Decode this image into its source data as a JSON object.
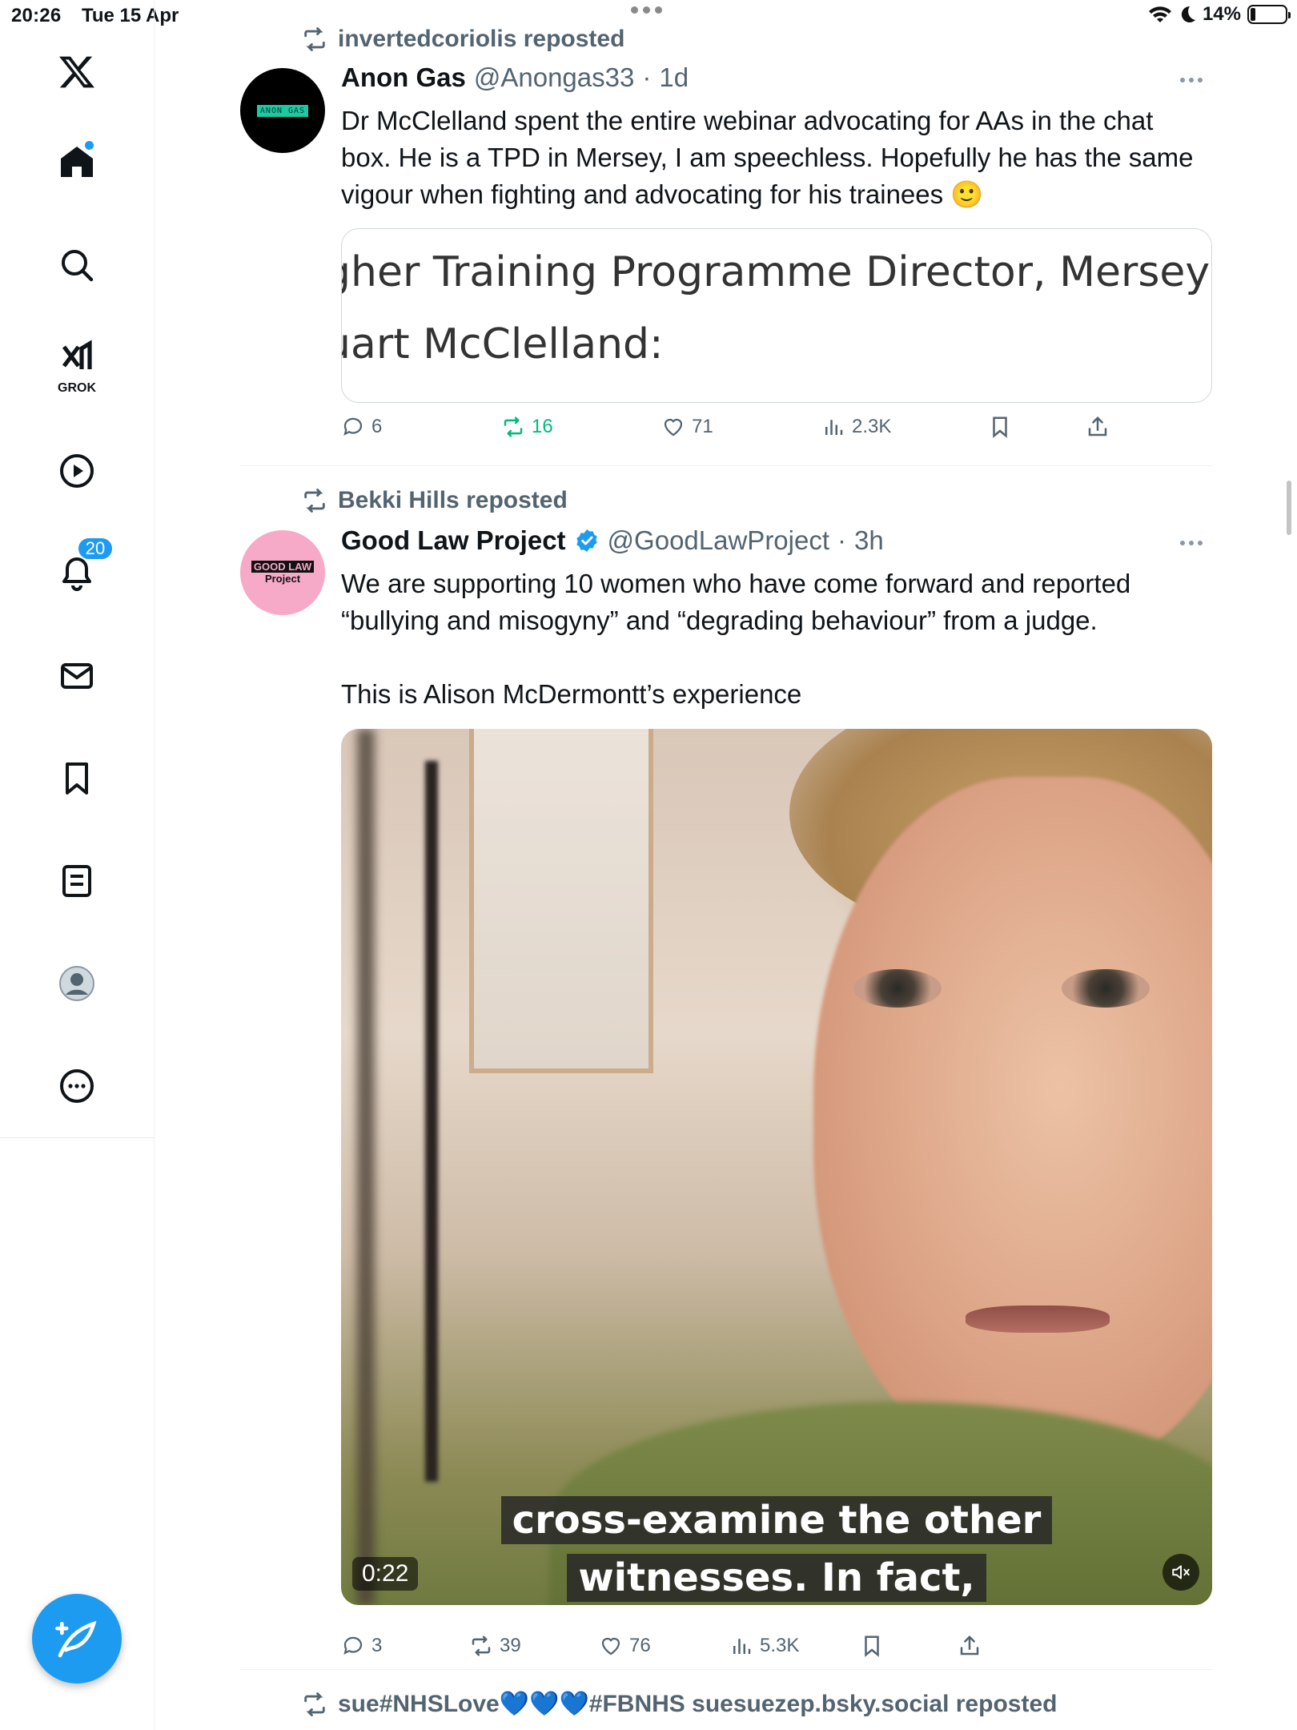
{
  "status_bar": {
    "time": "20:26",
    "date": "Tue 15 Apr",
    "battery": "14%",
    "battery_level": 0.14
  },
  "sidebar": {
    "items": [
      {
        "name": "logo",
        "icon": "x-logo-icon"
      },
      {
        "name": "home",
        "icon": "home-icon",
        "has_dot": true
      },
      {
        "name": "explore",
        "icon": "search-icon"
      },
      {
        "name": "grok",
        "icon": "grok-icon",
        "label": "GROK"
      },
      {
        "name": "video",
        "icon": "play-icon"
      },
      {
        "name": "notifications",
        "icon": "bell-icon",
        "badge": "20"
      },
      {
        "name": "messages",
        "icon": "mail-icon"
      },
      {
        "name": "bookmarks",
        "icon": "bookmark-icon"
      },
      {
        "name": "lists",
        "icon": "list-icon"
      },
      {
        "name": "profile",
        "icon": "avatar-icon"
      },
      {
        "name": "more",
        "icon": "more-circle-icon"
      }
    ],
    "compose_icon": "compose-feather-icon"
  },
  "tweets": [
    {
      "reposted_by": "invertedcoriolis reposted",
      "name": "Anon Gas",
      "handle": "@Anongas33",
      "dot": "·",
      "time": "1d",
      "avatar_text": "ANON GAS",
      "text": "Dr McClelland spent the entire webinar advocating for AAs in the chat box. He is a TPD in Mersey, I am speechless. Hopefully he has the same vigour when fighting and advocating for his trainees 🙂",
      "quote_lines": [
        "gher Training Programme Director, Mersey – Dr",
        "uart McClelland:"
      ],
      "stats": {
        "replies": "6",
        "reposts": "16",
        "likes": "71",
        "views": "2.3K"
      },
      "reposted_by_me": true
    },
    {
      "reposted_by": "Bekki Hills reposted",
      "name": "Good Law Project",
      "verified": true,
      "handle": "@GoodLawProject",
      "dot": "·",
      "time": "3h",
      "avatar_text_1": "GOOD LAW",
      "avatar_text_2": "Project",
      "text": "We are supporting 10 women who have come forward and reported “bullying and misogyny” and “degrading behaviour” from a judge.\n\nThis is Alison McDermontt’s experience",
      "video": {
        "caption_line_1": "cross-examine the other",
        "caption_line_2": "witnesses. In fact,",
        "duration": "0:22",
        "muted": true
      },
      "stats": {
        "replies": "3",
        "reposts": "39",
        "likes": "76",
        "views": "5.3K"
      }
    },
    {
      "reposted_by": "sue#NHSLove💙💙💙#FBNHS suesuezep.bsky.social reposted"
    }
  ],
  "colors": {
    "accent": "#1d9bf0",
    "repost_green": "#00ba7c",
    "secondary_text": "#536471",
    "goodlaw_pink": "#f7a9c8"
  }
}
